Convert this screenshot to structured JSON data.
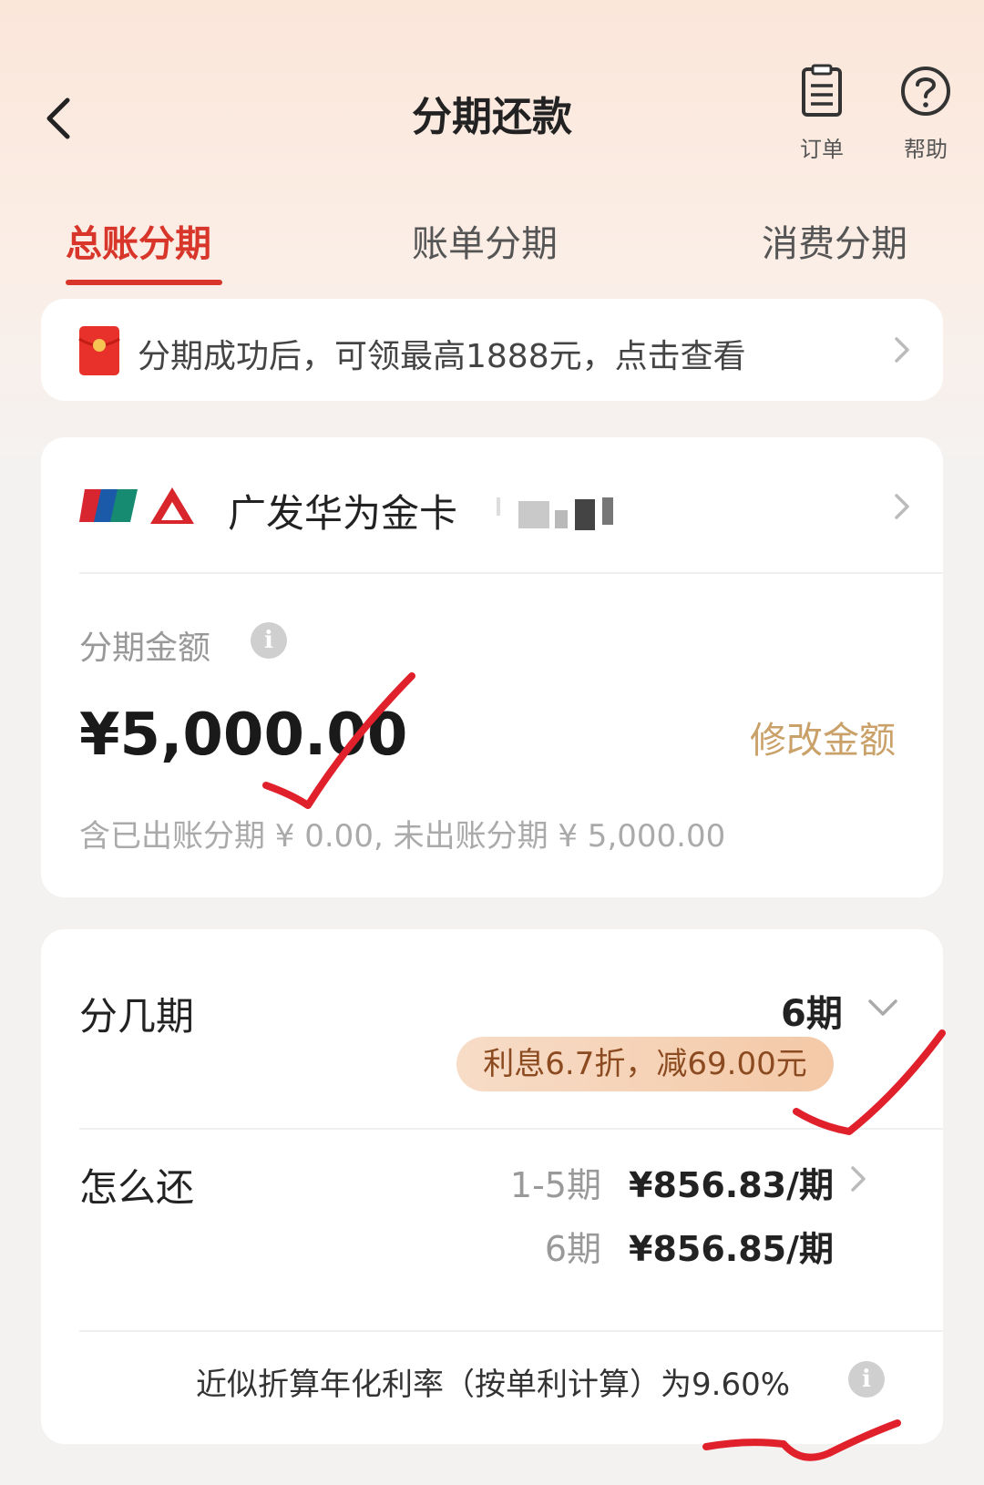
{
  "header": {
    "title": "分期还款",
    "orders_label": "订单",
    "help_label": "帮助"
  },
  "tabs": [
    {
      "label": "总账分期",
      "active": true
    },
    {
      "label": "账单分期",
      "active": false
    },
    {
      "label": "消费分期",
      "active": false
    }
  ],
  "promo": {
    "text": "分期成功后，可领最高1888元，点击查看"
  },
  "card": {
    "name": "广发华为金卡"
  },
  "amount": {
    "label": "分期金额",
    "value": "¥5,000.00",
    "edit_label": "修改金额",
    "breakdown": "含已出账分期 ¥ 0.00, 未出账分期 ¥ 5,000.00"
  },
  "plan": {
    "periods_label": "分几期",
    "periods_value": "6期",
    "discount_badge": "利息6.7折，减69.00元",
    "repay_label": "怎么还",
    "repay_lines": [
      {
        "periods": "1-5期",
        "amount": "¥856.83/期"
      },
      {
        "periods": "6期",
        "amount": "¥856.85/期"
      }
    ],
    "apr_text": "近似折算年化利率（按单利计算）为9.60%"
  },
  "colors": {
    "accent_red": "#d8352b",
    "gold_link": "#c9a169",
    "annotation_red": "#e0202a"
  }
}
